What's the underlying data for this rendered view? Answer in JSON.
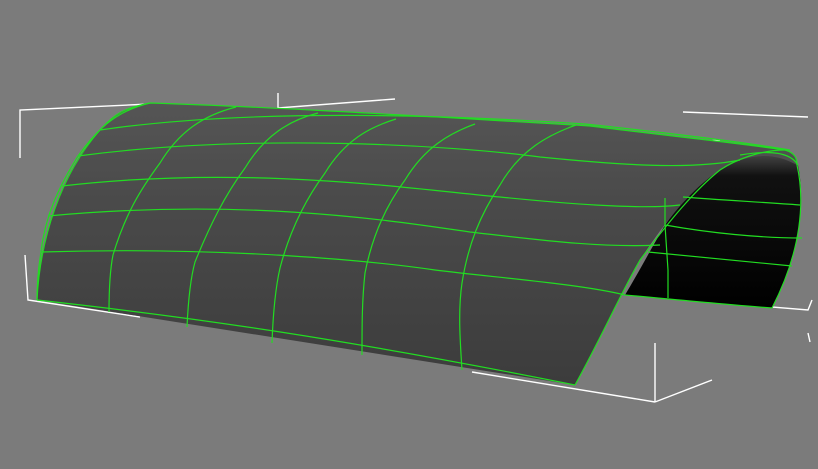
{
  "viewport": {
    "background_color": "#7b7b7b",
    "object": {
      "type": "curved surface (half-cylinder shell)",
      "surface_color_front": "#3d3d3d",
      "surface_color_inner": "#000000",
      "wireframe_color": "#22dd22",
      "selected": true
    },
    "bounding_box": {
      "line_color": "#ffffff",
      "style": "corner brackets"
    }
  }
}
